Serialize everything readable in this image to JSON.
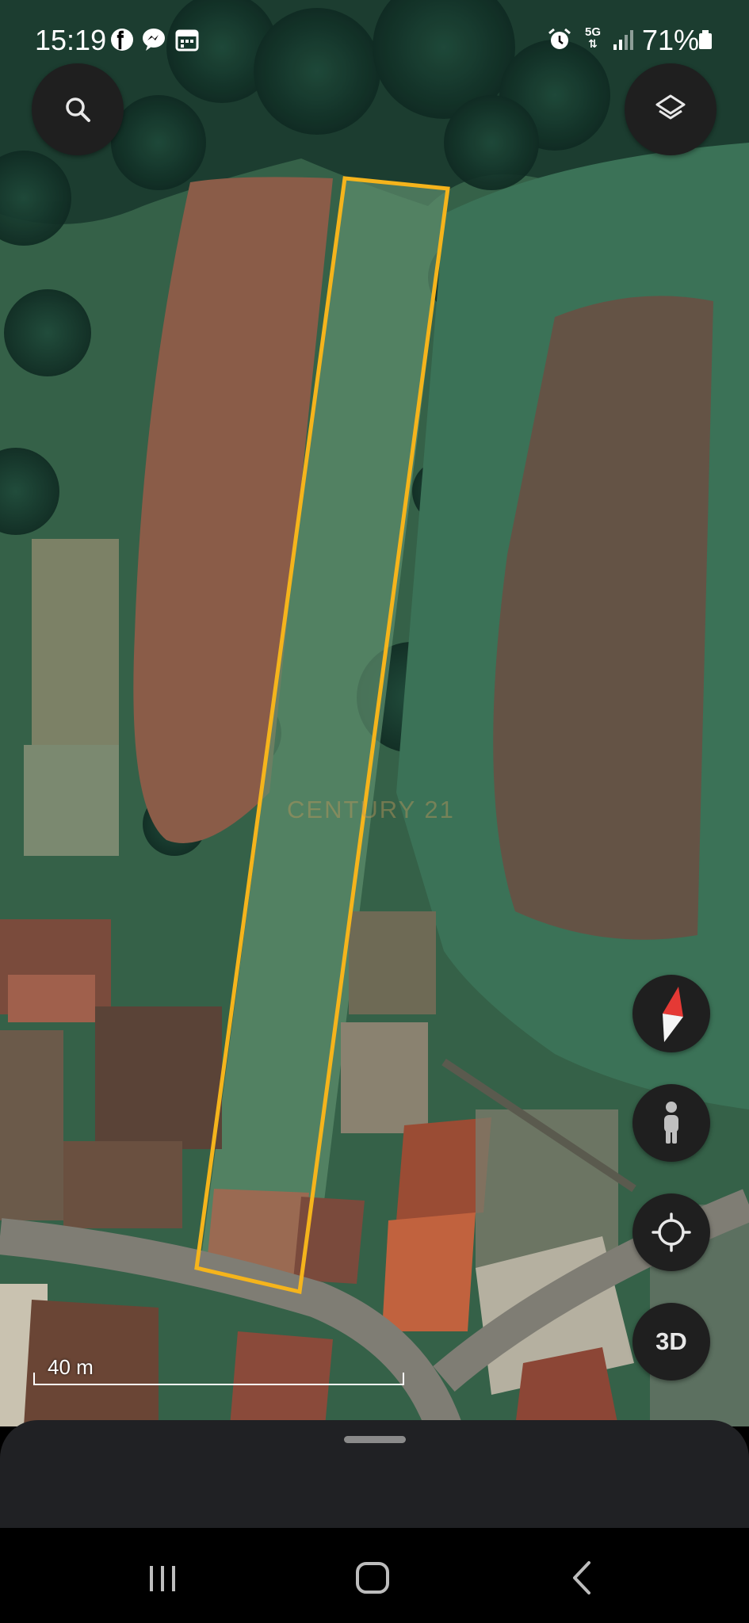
{
  "status_bar": {
    "time": "15:19",
    "left_icons": [
      "facebook-icon",
      "messenger-icon",
      "calendar-icon"
    ],
    "right_icons": [
      "alarm-icon",
      "5g-icon",
      "signal-icon"
    ],
    "network_label": "5G",
    "battery_percent": "71%",
    "battery_level": 0.71
  },
  "map": {
    "watermark": "CENTURY 21",
    "parcel_outline_color": "#f5b41c",
    "scale_label": "40 m"
  },
  "controls": {
    "search_icon": "search-icon",
    "layers_icon": "layers-icon",
    "compass_icon": "compass-icon",
    "street_view_icon": "pegman-icon",
    "my_location_icon": "my-location-icon",
    "three_d_label": "3D"
  },
  "nav_bar": {
    "icons": [
      "recent-apps-icon",
      "home-icon",
      "back-icon"
    ]
  },
  "colors": {
    "button_bg": "#1f1f1f",
    "sheet_bg": "#202124",
    "compass_red": "#e53935"
  }
}
